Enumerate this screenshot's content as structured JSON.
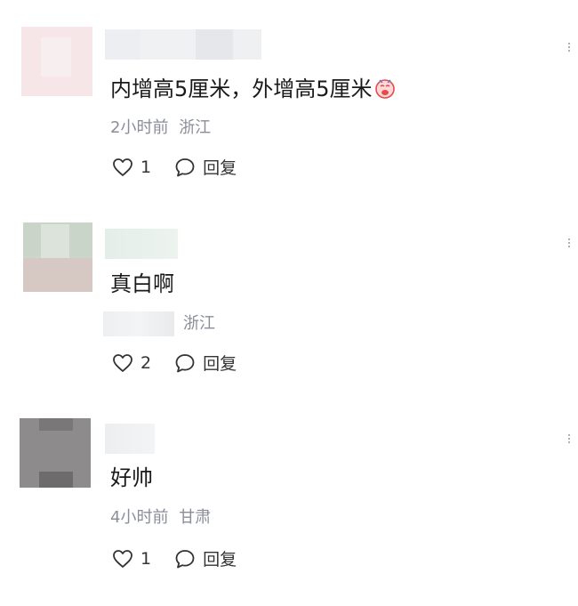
{
  "comments": [
    {
      "text": "内增高5厘米，外增高5厘米",
      "time": "2小时前",
      "location": "浙江",
      "likes": "1",
      "reply_label": "回复",
      "emoji": "crying-face-icon"
    },
    {
      "text": "真白啊",
      "time": "",
      "location": "浙江",
      "likes": "2",
      "reply_label": "回复"
    },
    {
      "text": "好帅",
      "time": "4小时前",
      "location": "甘肃",
      "likes": "1",
      "reply_label": "回复"
    }
  ],
  "colors": {
    "meta": "#8a8e99",
    "text": "#1a1a1a",
    "emoji": "#e84a4a"
  }
}
